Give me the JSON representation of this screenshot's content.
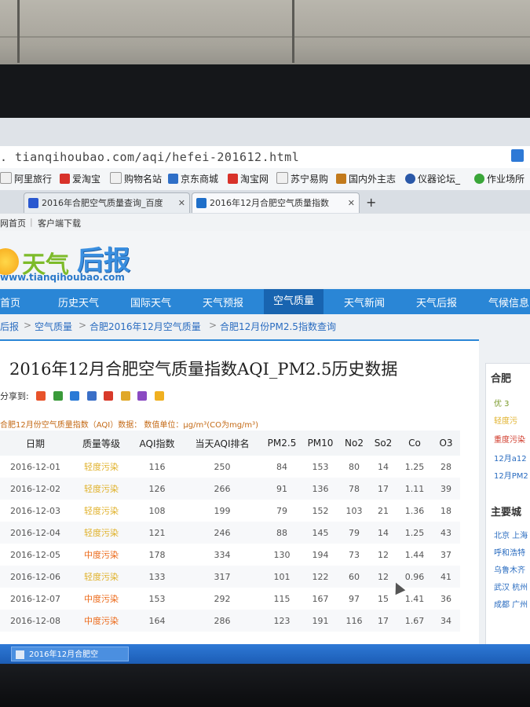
{
  "browser": {
    "address": ". tianqihoubao.com/aqi/hefei-201612.html",
    "bookmarks": [
      "阿里旅行",
      "爱淘宝",
      "购物名站",
      "京东商城",
      "淘宝网",
      "苏宁易购",
      "国内外主志",
      "仪器论坛_",
      "作业场所"
    ],
    "tabs": [
      {
        "label": "2016年合肥空气质量查询_百度",
        "active": false
      },
      {
        "label": "2016年12月合肥空气质量指数",
        "active": true
      }
    ],
    "new_tab_symbol": "+"
  },
  "page_links": [
    "网首页",
    "客户端下载"
  ],
  "logo": {
    "text1": "天气",
    "text2": "后报",
    "url": "www.tianqihoubao.com"
  },
  "nav": {
    "items": [
      "首页",
      "历史天气",
      "国际天气",
      "天气预报",
      "空气质量",
      "天气新闻",
      "天气后报",
      "气候信息"
    ],
    "active": "空气质量"
  },
  "breadcrumb": [
    "后报",
    ">",
    "空气质量",
    ">",
    "合肥2016年12月空气质量",
    ">",
    "合肥12月份PM2.5指数查询"
  ],
  "page_title": "2016年12月合肥空气质量指数AQI_PM2.5历史数据",
  "share_label": "分享到:",
  "unit_line": "合肥12月份空气质量指数（AQI）数据：  数值单位：μg/m³(CO为mg/m³)",
  "table": {
    "headers": [
      "日期",
      "质量等级",
      "AQI指数",
      "当天AQI排名",
      "PM2.5",
      "PM10",
      "No2",
      "So2",
      "Co",
      "O3"
    ],
    "rows": [
      [
        "2016-12-01",
        "轻度污染",
        "116",
        "250",
        "84",
        "153",
        "80",
        "14",
        "1.25",
        "28"
      ],
      [
        "2016-12-02",
        "轻度污染",
        "126",
        "266",
        "91",
        "136",
        "78",
        "17",
        "1.11",
        "39"
      ],
      [
        "2016-12-03",
        "轻度污染",
        "108",
        "199",
        "79",
        "152",
        "103",
        "21",
        "1.36",
        "18"
      ],
      [
        "2016-12-04",
        "轻度污染",
        "121",
        "246",
        "88",
        "145",
        "79",
        "14",
        "1.25",
        "43"
      ],
      [
        "2016-12-05",
        "中度污染",
        "178",
        "334",
        "130",
        "194",
        "73",
        "12",
        "1.44",
        "37"
      ],
      [
        "2016-12-06",
        "轻度污染",
        "133",
        "317",
        "101",
        "122",
        "60",
        "12",
        "0.96",
        "41"
      ],
      [
        "2016-12-07",
        "中度污染",
        "153",
        "292",
        "115",
        "167",
        "97",
        "15",
        "1.41",
        "36"
      ],
      [
        "2016-12-08",
        "中度污染",
        "164",
        "286",
        "123",
        "191",
        "116",
        "17",
        "1.67",
        "34"
      ]
    ],
    "level_colors": {
      "轻度污染": "#e0b12a",
      "中度污染": "#ec6a1a"
    }
  },
  "sidebar": {
    "heading": "合肥",
    "lines": [
      {
        "text": "优 3",
        "color": "#7a9a2a"
      },
      {
        "text": "轻度污",
        "color": "#e0b12a"
      },
      {
        "text": "重度污染",
        "color": "#d03a2a"
      },
      {
        "text": "12月a12",
        "color": "#2a6cc0"
      },
      {
        "text": "12月PM2",
        "color": "#2a6cc0"
      }
    ],
    "cities_heading": "主要城",
    "cities": [
      "北京 上海",
      "呼和浩特",
      "乌鲁木齐",
      "武汉 杭州",
      "成都 广州"
    ]
  },
  "taskbar": {
    "window_label": "2016年12月合肥空"
  },
  "accent": "#2a86d6"
}
